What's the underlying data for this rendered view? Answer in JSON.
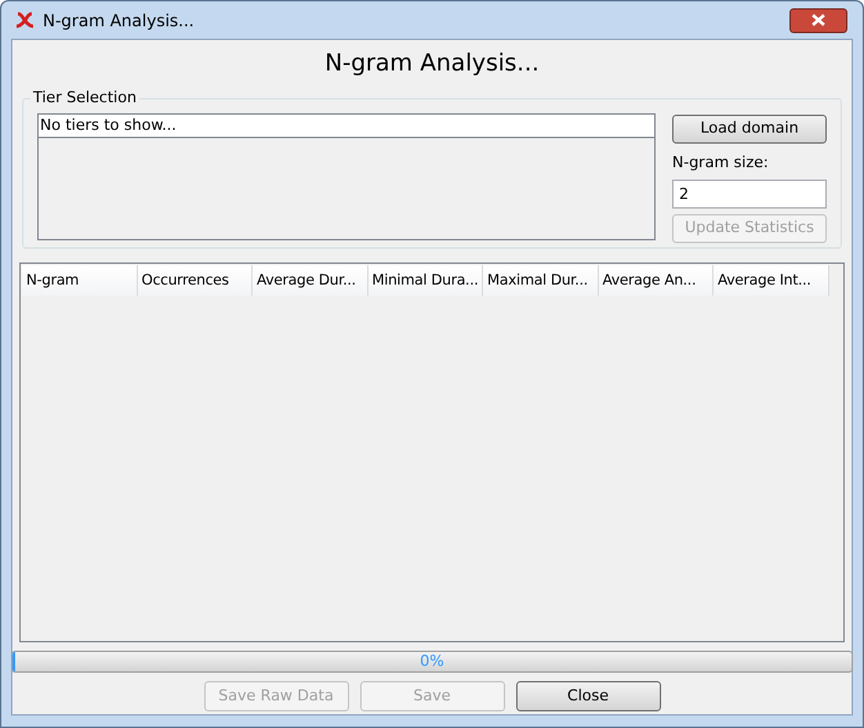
{
  "window": {
    "title": "N-gram Analysis..."
  },
  "heading": "N-gram Analysis...",
  "tier_selection": {
    "title": "Tier Selection",
    "items": [
      {
        "label": "No tiers to show...",
        "selected": false
      }
    ]
  },
  "load_button": {
    "label": "Load domain",
    "disabled": false
  },
  "ngram_size": {
    "label": "N-gram size:",
    "value": "2"
  },
  "update_button": {
    "label": "Update Statistics",
    "disabled": true
  },
  "table": {
    "columns": [
      "N-gram",
      "Occurrences",
      "Average Dur...",
      "Minimal Dura...",
      "Maximal Dur...",
      "Average An...",
      "Average Int..."
    ]
  },
  "progress": {
    "level": 0,
    "text": "0%"
  },
  "buttons": [
    {
      "label": "Save Raw Data",
      "disabled": true
    },
    {
      "label": "Save",
      "disabled": true
    },
    {
      "label": "Close",
      "disabled": false
    }
  ]
}
